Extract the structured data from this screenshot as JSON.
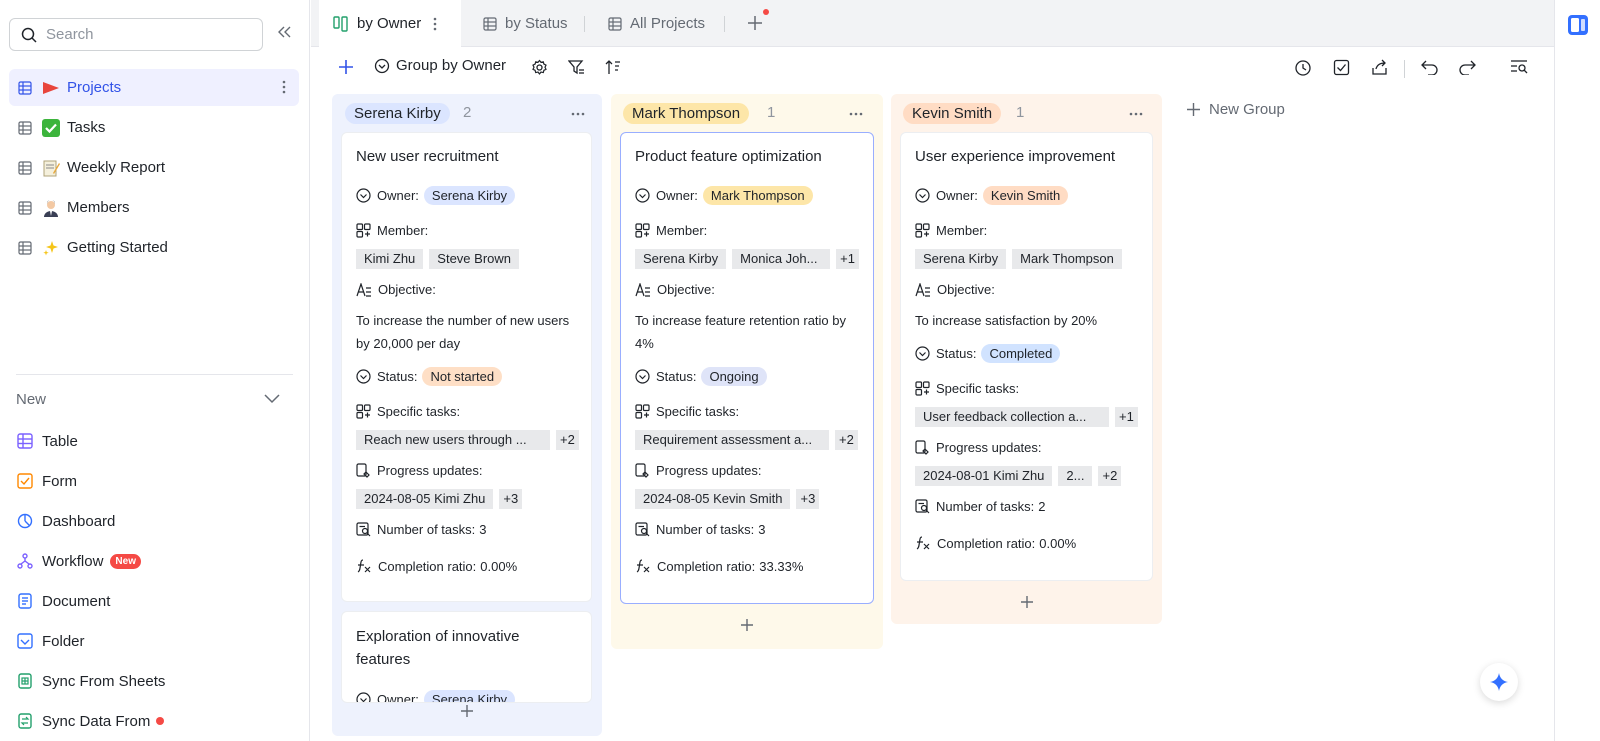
{
  "sidebar": {
    "search_placeholder": "Search",
    "items": [
      {
        "emoji": "🚩",
        "label": "Projects"
      },
      {
        "emoji": "✅",
        "label": "Tasks"
      },
      {
        "emoji": "📝",
        "label": "Weekly Report"
      },
      {
        "emoji": "👨🏻‍💼",
        "label": "Members"
      },
      {
        "emoji": "✨",
        "label": "Getting Started"
      }
    ],
    "new_header": "New",
    "new_items": [
      {
        "label": "Table"
      },
      {
        "label": "Form"
      },
      {
        "label": "Dashboard"
      },
      {
        "label": "Workflow",
        "badge": "New"
      },
      {
        "label": "Document"
      },
      {
        "label": "Folder"
      },
      {
        "label": "Sync From Sheets"
      },
      {
        "label": "Sync Data From"
      }
    ]
  },
  "tabs": [
    {
      "label": "by Owner"
    },
    {
      "label": "by Status"
    },
    {
      "label": "All Projects"
    }
  ],
  "toolbar": {
    "group_label": "Group by Owner"
  },
  "board": {
    "new_group": "New Group",
    "field_labels": {
      "owner": "Owner:",
      "member": "Member:",
      "objective": "Objective:",
      "status": "Status:",
      "specific_tasks": "Specific tasks:",
      "progress": "Progress updates:",
      "num_tasks": "Number of tasks:",
      "completion": "Completion ratio:"
    },
    "columns": [
      {
        "name": "Serena Kirby",
        "count": "2",
        "cards": [
          {
            "title": "New user recruitment",
            "owner": "Serena Kirby",
            "members": [
              "Kimi Zhu",
              "Steve Brown"
            ],
            "objective_line1": "To increase the number of new users",
            "objective_line2": "by 20,000 per day",
            "status": "Not started",
            "tasks": [
              "Reach new users through ...",
              "+2"
            ],
            "progress": [
              "2024-08-05 Kimi Zhu",
              "+3"
            ],
            "num_tasks": "3",
            "completion": "0.00%"
          },
          {
            "title_line1": "Exploration of innovative",
            "title_line2": "features",
            "owner": "Serena Kirby"
          }
        ]
      },
      {
        "name": "Mark Thompson",
        "count": "1",
        "cards": [
          {
            "title": "Product feature optimization",
            "owner": "Mark Thompson",
            "members": [
              "Serena Kirby",
              "Monica Joh...",
              "+1"
            ],
            "objective_line1": "To increase feature retention ratio by",
            "objective_line2": "4%",
            "status": "Ongoing",
            "tasks": [
              "Requirement assessment a...",
              "+2"
            ],
            "progress": [
              "2024-08-05 Kevin Smith",
              "+3"
            ],
            "num_tasks": "3",
            "completion": "33.33%"
          }
        ]
      },
      {
        "name": "Kevin Smith",
        "count": "1",
        "cards": [
          {
            "title": "User experience improvement",
            "owner": "Kevin Smith",
            "members": [
              "Serena Kirby",
              "Mark Thompson"
            ],
            "objective_line1": "To increase satisfaction by 20%",
            "status": "Completed",
            "tasks": [
              "User feedback collection a...",
              "+1"
            ],
            "progress": [
              "2024-08-01 Kimi Zhu",
              "2...",
              "+2"
            ],
            "num_tasks": "2",
            "completion": "0.00%"
          }
        ]
      }
    ]
  },
  "colors": {
    "accent": "#3253e8",
    "serena_chip": "#dbe5ff",
    "mark_chip": "#fde6a8",
    "kevin_chip": "#ffdcc4",
    "col_blue_bg": "#eef2fd",
    "col_yellow_bg": "#fef9ea",
    "col_orange_bg": "#fef3ea",
    "status_not_started": "#fedfc6",
    "status_ongoing": "#dfe4f8",
    "status_completed": "#d1e3ff"
  }
}
